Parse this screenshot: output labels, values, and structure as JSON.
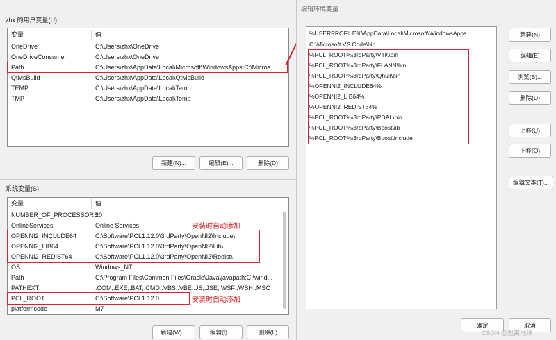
{
  "user_vars": {
    "section_title": "zhx 的用户变量(U)",
    "col_var": "变量",
    "col_val": "值",
    "rows": [
      {
        "name": "OneDrive",
        "value": "C:\\Users\\zhx\\OneDrive"
      },
      {
        "name": "OneDriveConsumer",
        "value": "C:\\Users\\zhx\\OneDrive"
      },
      {
        "name": "Path",
        "value": "C:\\Users\\zhx\\AppData\\Local\\Microsoft\\WindowsApps;C:\\Micros..."
      },
      {
        "name": "QtMsBuild",
        "value": "C:\\Users\\zhx\\AppData\\Local\\QtMsBuild"
      },
      {
        "name": "TEMP",
        "value": "C:\\Users\\zhx\\AppData\\Local\\Temp"
      },
      {
        "name": "TMP",
        "value": "C:\\Users\\zhx\\AppData\\Local\\Temp"
      }
    ],
    "buttons": {
      "new": "新建(N)...",
      "edit": "编辑(E)...",
      "delete": "删除(D)"
    }
  },
  "system_vars": {
    "section_title": "系统变量(S)",
    "col_var": "变量",
    "col_val": "值",
    "rows": [
      {
        "name": "NUMBER_OF_PROCESSORS",
        "value": "20"
      },
      {
        "name": "OnlineServices",
        "value": "Online Services"
      },
      {
        "name": "OPENNI2_INCLUDE64",
        "value": "C:\\Software\\PCL1.12.0\\3rdParty\\OpenNI2\\Include\\"
      },
      {
        "name": "OPENNI2_LIB64",
        "value": "C:\\Software\\PCL1.12.0\\3rdParty\\OpenNI2\\Lib\\"
      },
      {
        "name": "OPENNI2_REDIST64",
        "value": "C:\\Software\\PCL1.12.0\\3rdParty\\OpenNI2\\Redist\\"
      },
      {
        "name": "OS",
        "value": "Windows_NT"
      },
      {
        "name": "Path",
        "value": "C:\\Program Files\\Common Files\\Oracle\\Java\\javapath;C:\\wind..."
      },
      {
        "name": "PATHEXT",
        "value": ".COM;.EXE;.BAT;.CMD;.VBS;.VBE;.JS;.JSE;.WSF;.WSH;.MSC"
      },
      {
        "name": "PCL_ROOT",
        "value": "C:\\Software\\PCL1.12.0"
      },
      {
        "name": "platformcode",
        "value": "M7"
      }
    ],
    "buttons": {
      "new": "新建(W)...",
      "edit": "编辑(I)...",
      "delete": "删除(L)"
    }
  },
  "annotations": {
    "auto_added_1": "安装时自动添加",
    "auto_added_2": "安装时自动添加"
  },
  "edit_dialog": {
    "title": "编辑环境变量",
    "entries": [
      "%USERPROFILE%\\AppData\\Local\\Microsoft\\WindowsApps",
      "C:\\Microsoft VS Code\\bin",
      "%PCL_ROOT%\\3rdParty\\VTK\\bin",
      "%PCL_ROOT%\\3rdParty\\FLANN\\bin",
      "%PCL_ROOT%\\3rdParty\\Qhull\\bin",
      "%OPENNI2_INCLUDE64%",
      "%OPENNI2_LIB64%",
      "%OPENNI2_REDIST64%",
      "%PCL_ROOT%\\3rdParty\\PDAL\\bin",
      "%PCL_ROOT%\\3rdParty\\Boost\\lib",
      "%PCL_ROOT%\\3rdParty\\Boost\\include"
    ],
    "buttons": {
      "new": "新建(N)",
      "edit": "编辑(E)",
      "browse": "浏览(B)...",
      "delete": "删除(D)",
      "up": "上移(U)",
      "down": "下移(O)",
      "edit_text": "编辑文本(T)...",
      "ok": "确定",
      "cancel": "取消"
    }
  },
  "watermark": "CSDN @逃离地球",
  "colors": {
    "annotation": "#d4262e",
    "dialog_bg": "#f0f0f0"
  }
}
